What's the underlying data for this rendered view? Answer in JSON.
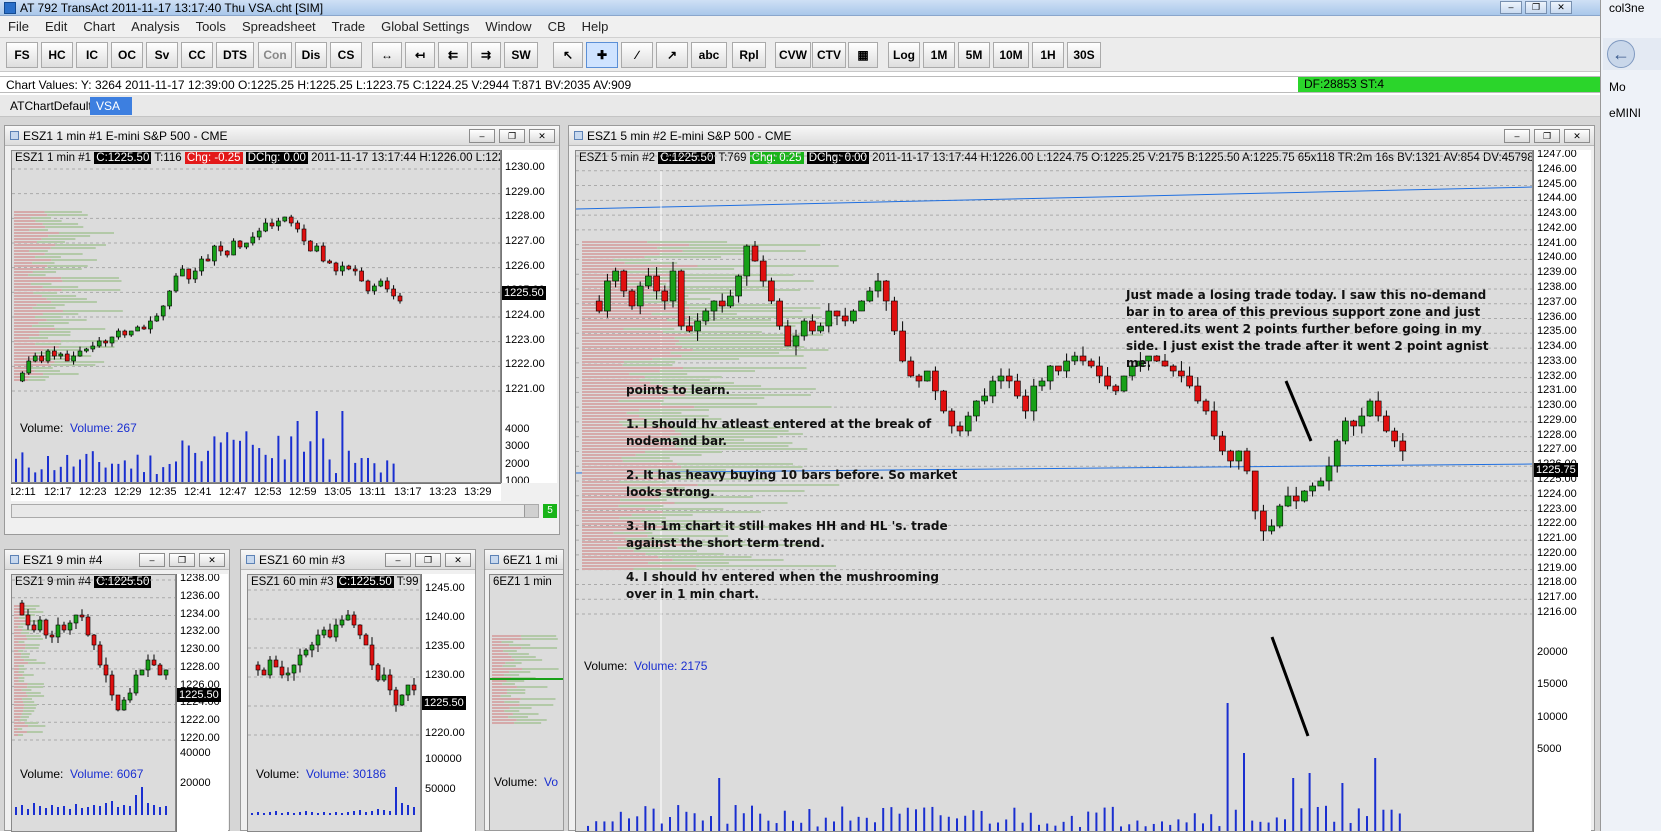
{
  "window": {
    "title": "AT 792 TransAct 2011-11-17  13:17:40 Thu   VSA.cht [SIM]"
  },
  "menu": [
    "File",
    "Edit",
    "Chart",
    "Analysis",
    "Tools",
    "Spreadsheet",
    "Trade",
    "Global Settings",
    "Window",
    "CB",
    "Help"
  ],
  "toolbar": {
    "buttons": [
      "FS",
      "HC",
      "IC",
      "OC",
      "Sv",
      "CC",
      "DTS",
      "Con",
      "Dis",
      "CS",
      "SW",
      "abc",
      "Rpl",
      "CVW",
      "CTV",
      "Log",
      "1M",
      "5M",
      "10M",
      "1H",
      "30S"
    ]
  },
  "values_bar": {
    "text": "Chart Values: Y: 3264  2011-11-17  12:39:00  O:1225.25  H:1225.25  L:1223.75  C:1224.25  V:2944  T:871  BV:2035  AV:909",
    "df": "DF:28853  ST:4"
  },
  "tabs": [
    {
      "label": "ATChartDefault"
    },
    {
      "label": "VSA"
    }
  ],
  "charts": {
    "c1": {
      "title": "ESZ1  1 min   #1  E-mini S&P 500 - CME",
      "info_pre": "ESZ1  1 min   #1",
      "close": "C:1225.50",
      "t": "T:116",
      "chg": "Chg: -0.25",
      "dchg": "DChg: 0.00",
      "info_post": "2011-11-17 13:17:44 H:1226.00 L:1225.",
      "price_ticks": [
        "1230.00",
        "1229.00",
        "1228.00",
        "1227.00",
        "1226.00",
        "1225.00",
        "1224.00",
        "1223.00",
        "1222.00",
        "1221.00"
      ],
      "last": "1225.50",
      "volume_label": "Volume:",
      "volume_value": "Volume: 267",
      "vol_ticks": [
        "4000",
        "3000",
        "2000",
        "1000"
      ],
      "time_ticks": [
        "12:11",
        "12:17",
        "12:23",
        "12:29",
        "12:35",
        "12:41",
        "12:47",
        "12:53",
        "12:59",
        "13:05",
        "13:11",
        "13:17",
        "13:23",
        "13:29"
      ],
      "badge": "5"
    },
    "c2": {
      "title": "ESZ1  5 min   #2  E-mini S&P 500 - CME",
      "info_pre": "ESZ1  5 min   #2",
      "close": "C:1225.50",
      "t": "T:769",
      "chg": "Chg: 0.25",
      "dchg": "DChg: 0.00",
      "info_post": "2011-11-17 13:17:44 H:1226.00 L:1224.75 O:1225.25 V:2175 B:1225.50 A:1225.75 65x118 TR:2m 16s BV:1321 AV:854 DV:457982 Volu",
      "price_ticks": [
        "1247.00",
        "1246.00",
        "1245.00",
        "1244.00",
        "1243.00",
        "1242.00",
        "1241.00",
        "1240.00",
        "1239.00",
        "1238.00",
        "1237.00",
        "1236.00",
        "1235.00",
        "1234.00",
        "1233.00",
        "1232.00",
        "1231.00",
        "1230.00",
        "1229.00",
        "1228.00",
        "1227.00",
        "1226.00",
        "1225.00",
        "1224.00",
        "1223.00",
        "1222.00",
        "1221.00",
        "1220.00",
        "1219.00",
        "1218.00",
        "1217.00",
        "1216.00"
      ],
      "last": "1225.75",
      "volume_label": "Volume:",
      "volume_value": "Volume: 2175",
      "vol_ticks": [
        "20000",
        "15000",
        "10000",
        "5000"
      ]
    },
    "c3": {
      "title": "ESZ1  9 min   #4",
      "info_pre": "ESZ1  9 min   #4",
      "close": "C:1225.50",
      "price_ticks": [
        "1238.00",
        "1236.00",
        "1234.00",
        "1232.00",
        "1230.00",
        "1228.00",
        "1226.00",
        "1224.00",
        "1222.00",
        "1220.00"
      ],
      "last": "1225.50",
      "volume_label": "Volume:",
      "volume_value": "Volume: 6067",
      "vol_ticks": [
        "40000",
        "20000"
      ]
    },
    "c4": {
      "title": "ESZ1  60 min   #3",
      "info_pre": "ESZ1  60 min   #3",
      "close": "C:1225.50",
      "t": "T:99",
      "price_ticks": [
        "1245.00",
        "1240.00",
        "1235.00",
        "1230.00",
        "1225.00",
        "1220.00"
      ],
      "last": "1225.50",
      "volume_label": "Volume:",
      "volume_value": "Volume: 30186",
      "vol_ticks": [
        "100000",
        "50000"
      ]
    },
    "c5": {
      "title": "6EZ1  1 mi",
      "info_pre": "6EZ1  1 min",
      "volume_label": "Volume:",
      "volume_value": "Vo"
    }
  },
  "annotations": {
    "trade_note": "Just made a losing trade today. I saw this no-demand\nbar in to area of this previous support zone and just\nentered.its went 2 points further before going in my\nside. I just exist the trade after it went 2 point agnist\nme.",
    "lessons": "points to learn.\n\n1. I should hv atleast entered at the break of\nnodemand bar.\n\n2. It has heavy buying 10 bars before. So market\nlooks strong.\n\n3. In 1m chart it still makes HH and HL 's. trade\nagainst the short term trend.\n\n4. I should hv entered when the mushrooming\nover in 1 min chart."
  },
  "right_panel": {
    "tab": "col3ne",
    "item1": "Mo",
    "item2": "eMINI"
  },
  "colors": {
    "up": "#18a018",
    "down": "#e01010",
    "volume": "#1a2fd0",
    "profile_buy": "#b3c9a8",
    "profile_sell": "#d5a9a9",
    "axis_bg": "#ffffff",
    "plot_bg": "#dcdcdc"
  },
  "icons": [
    "app-icon",
    "minimize-icon",
    "restore-icon",
    "close-icon",
    "cursor-icon",
    "crosshair-icon",
    "trendline-icon",
    "ray-icon",
    "back-arrow-icon",
    "grid-table-icon"
  ]
}
